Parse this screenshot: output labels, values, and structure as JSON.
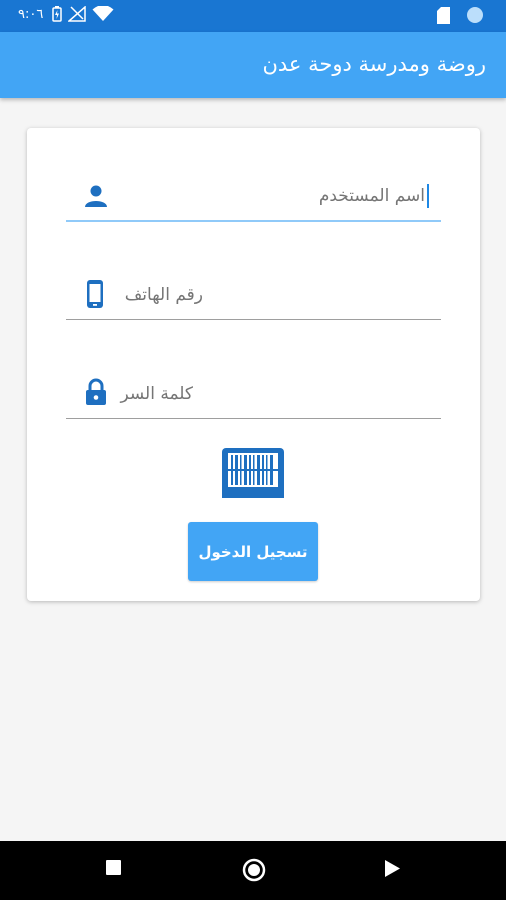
{
  "status_bar": {
    "time": "٩:٠٦",
    "left_icons": [
      "battery-charging-icon",
      "no-signal-icon",
      "wifi-icon"
    ],
    "right_icons": [
      "sd-card-icon",
      "sync-circle-icon"
    ]
  },
  "app_bar": {
    "title": "روضة ومدرسة دوحة عدن"
  },
  "form": {
    "username": {
      "label": "اسم المستخدم",
      "icon": "person-icon"
    },
    "phone": {
      "label": "رقم الهاتف",
      "icon": "smartphone-icon"
    },
    "password": {
      "label": "كلمة السر",
      "icon": "lock-icon"
    },
    "barcode_icon": "barcode-scanner-icon",
    "login_label": "تسجيل الدخول"
  },
  "nav_bar": {
    "buttons": [
      "recents-square-icon",
      "home-circle-icon",
      "back-triangle-icon"
    ]
  },
  "colors": {
    "status_bar": "#1976d2",
    "app_bar": "#42a5f5",
    "accent": "#1e6fc0",
    "active_underline": "#90caf9",
    "background": "#f5f5f5"
  }
}
